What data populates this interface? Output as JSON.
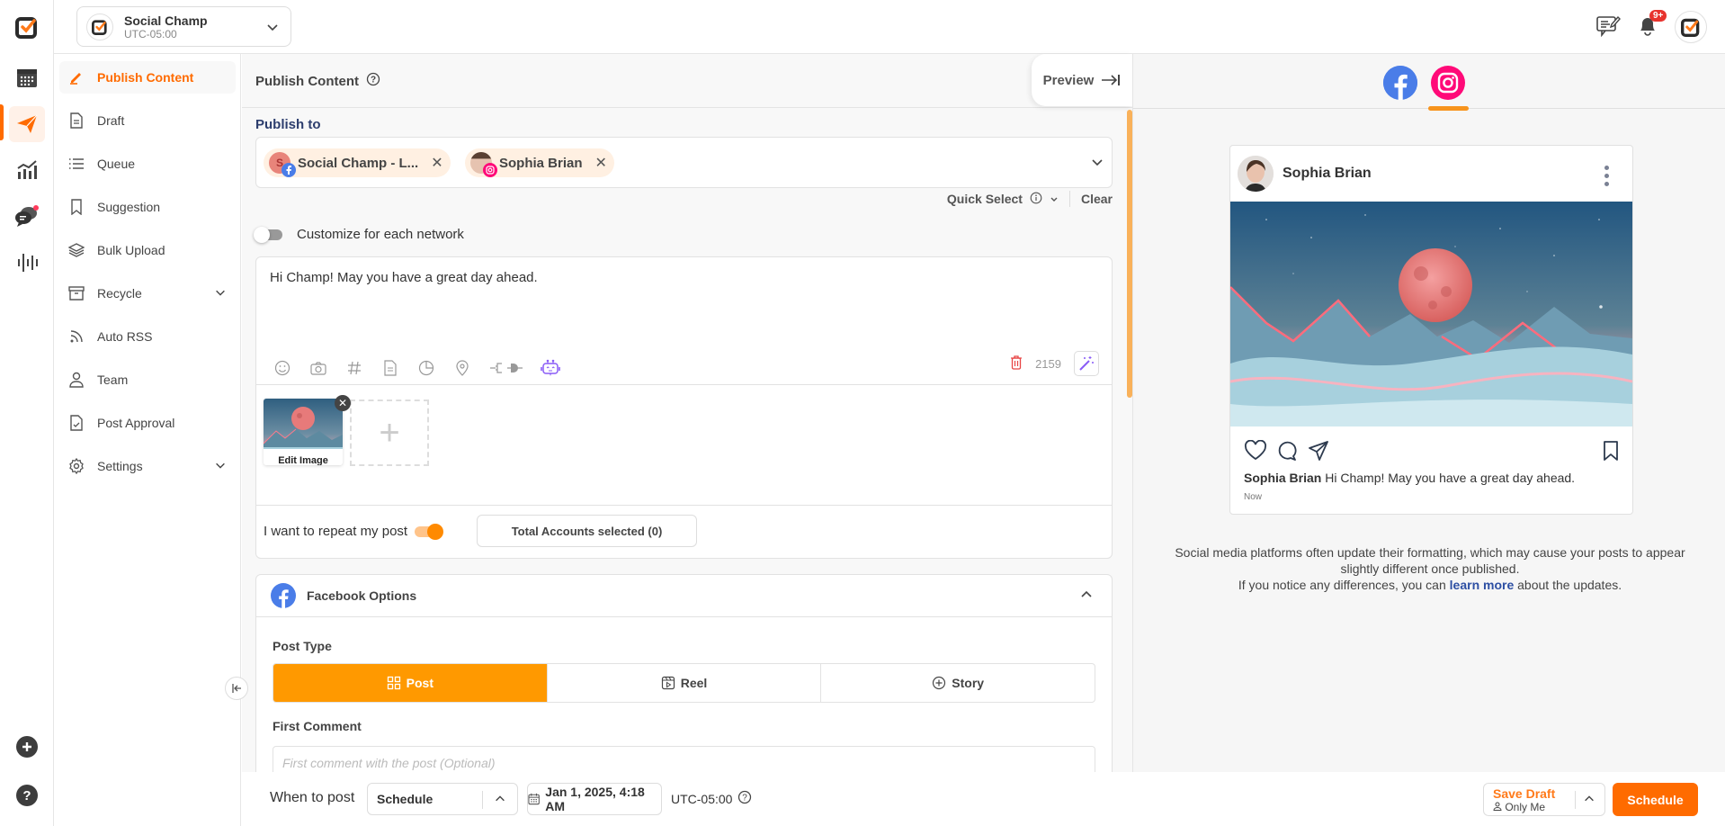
{
  "topbar": {
    "account_name": "Social Champ",
    "account_timezone": "UTC-05:00",
    "notifications_badge": "9+"
  },
  "rail": {
    "items": [
      "logo-icon",
      "calendar-icon",
      "publish-icon",
      "analytics-icon",
      "inbox-icon",
      "listening-icon"
    ],
    "bottom": [
      "add-icon",
      "help-icon"
    ]
  },
  "sidebar": {
    "items": [
      {
        "label": "Publish Content",
        "icon": "pencil-icon",
        "active": true
      },
      {
        "label": "Draft",
        "icon": "document-icon"
      },
      {
        "label": "Queue",
        "icon": "list-icon"
      },
      {
        "label": "Suggestion",
        "icon": "bookmark-icon"
      },
      {
        "label": "Bulk Upload",
        "icon": "layers-icon"
      },
      {
        "label": "Recycle",
        "icon": "archive-icon",
        "expandable": true
      },
      {
        "label": "Auto RSS",
        "icon": "rss-icon"
      },
      {
        "label": "Team",
        "icon": "user-icon"
      },
      {
        "label": "Post Approval",
        "icon": "approval-icon"
      },
      {
        "label": "Settings",
        "icon": "gear-icon",
        "expandable": true
      }
    ]
  },
  "main": {
    "title": "Publish Content",
    "preview_label": "Preview",
    "publish_to_label": "Publish to",
    "chips": [
      {
        "label": "Social Champ - L...",
        "network": "facebook",
        "initial": "S"
      },
      {
        "label": "Sophia Brian",
        "network": "instagram"
      }
    ],
    "quick_select_label": "Quick Select",
    "clear_label": "Clear",
    "customize_label": "Customize for each network",
    "customize_on": false,
    "post_text": "Hi Champ! May you have a great day ahead.",
    "char_count": "2159",
    "edit_image_label": "Edit Image",
    "repeat_label": "I want to repeat my post",
    "repeat_on": true,
    "total_accounts_label": "Total Accounts selected (0)",
    "facebook_options": {
      "title": "Facebook Options",
      "post_type_label": "Post Type",
      "post_types": [
        "Post",
        "Reel",
        "Story"
      ],
      "selected_post_type": "Post",
      "first_comment_label": "First Comment",
      "first_comment_placeholder": "First comment with the post (Optional)"
    }
  },
  "bottombar": {
    "when_label": "When to post",
    "schedule_option": "Schedule",
    "date_value": "Jan 1, 2025, 4:18 AM",
    "timezone": "UTC-05:00",
    "save_draft_label": "Save Draft",
    "save_draft_visibility": "Only Me",
    "schedule_button": "Schedule"
  },
  "preview": {
    "networks": [
      "facebook",
      "instagram"
    ],
    "active_network": "instagram",
    "username": "Sophia Brian",
    "caption": "Hi Champ! May you have a great day ahead.",
    "timestamp": "Now",
    "note_line1": "Social media platforms often update their formatting, which may cause your posts to appear slightly different once published.",
    "note_line2_pre": "If you notice any differences, you can ",
    "note_link": "learn more",
    "note_line2_post": " about the updates."
  },
  "colors": {
    "brand_orange": "#ff6b00",
    "segment_active": "#ff9900",
    "facebook_blue": "#4a7de8",
    "instagram_pink": "#ff0a78",
    "heading_navy": "#2d3e6e"
  }
}
